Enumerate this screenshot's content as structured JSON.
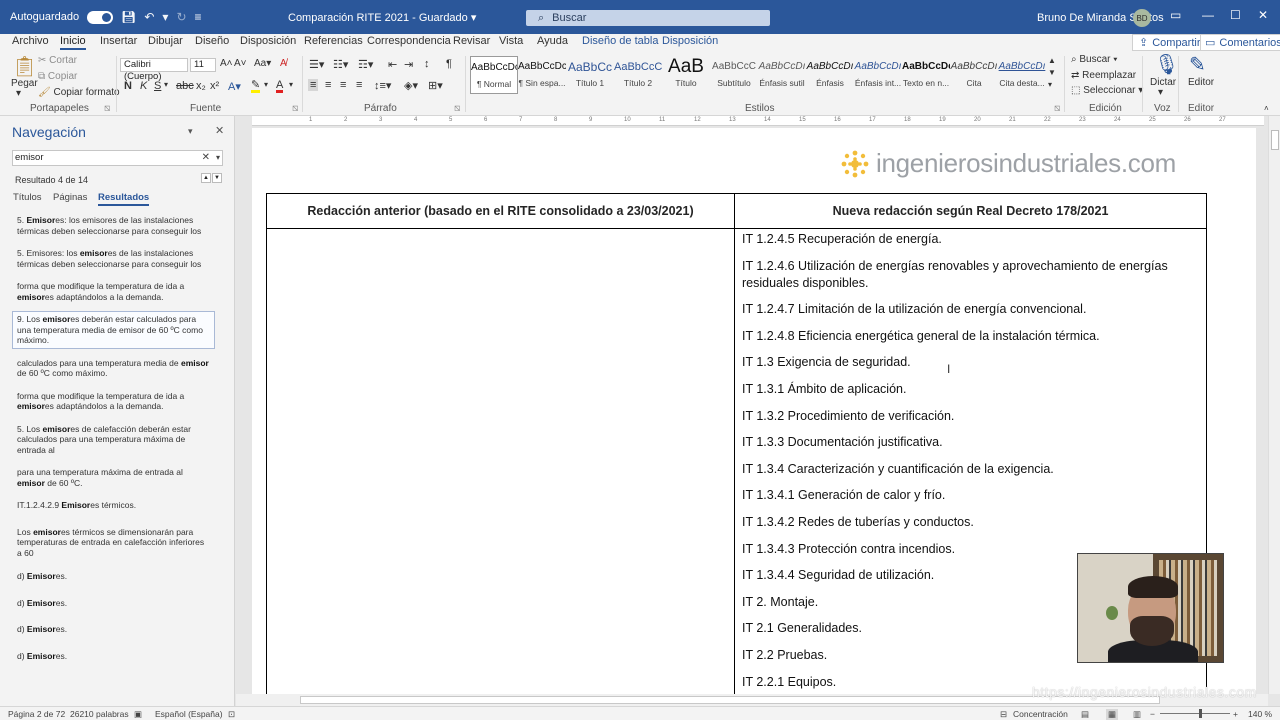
{
  "titlebar": {
    "autosave_label": "Autoguardado",
    "doc_title": "Comparación RITE 2021",
    "save_state": "Guardado",
    "search_placeholder": "Buscar",
    "user_name": "Bruno De Miranda Santos",
    "user_initials": "BD"
  },
  "menu": {
    "tabs": [
      "Archivo",
      "Inicio",
      "Insertar",
      "Dibujar",
      "Diseño",
      "Disposición",
      "Referencias",
      "Correspondencia",
      "Revisar",
      "Vista",
      "Ayuda",
      "Diseño de tabla",
      "Disposición"
    ],
    "active_tab": "Inicio",
    "share": "Compartir",
    "comments": "Comentarios"
  },
  "ribbon": {
    "clipboard": {
      "paste": "Pegar",
      "cut": "Cortar",
      "copy": "Copiar",
      "format_painter": "Copiar formato",
      "label": "Portapapeles"
    },
    "font": {
      "name": "Calibri (Cuerpo)",
      "size": "11",
      "label": "Fuente"
    },
    "paragraph": {
      "label": "Párrafo"
    },
    "styles": {
      "label": "Estilos",
      "items": [
        {
          "sample": "AaBbCcDc",
          "name": "¶ Normal"
        },
        {
          "sample": "AaBbCcDc",
          "name": "¶ Sin espa..."
        },
        {
          "sample": "AaBbCc",
          "name": "Título 1"
        },
        {
          "sample": "AaBbCcC",
          "name": "Título 2"
        },
        {
          "sample": "AaB",
          "name": "Título"
        },
        {
          "sample": "AaBbCcC",
          "name": "Subtítulo"
        },
        {
          "sample": "AaBbCcDı",
          "name": "Énfasis sutil"
        },
        {
          "sample": "AaBbCcDı",
          "name": "Énfasis"
        },
        {
          "sample": "AaBbCcDı",
          "name": "Énfasis int..."
        },
        {
          "sample": "AaBbCcDc",
          "name": "Texto en n..."
        },
        {
          "sample": "AaBbCcDı",
          "name": "Cita"
        },
        {
          "sample": "AaBbCcDı",
          "name": "Cita desta..."
        }
      ]
    },
    "editing": {
      "find": "Buscar",
      "replace": "Reemplazar",
      "select": "Seleccionar",
      "label": "Edición"
    },
    "voice": {
      "dictate": "Dictar",
      "label": "Voz"
    },
    "editor": {
      "button": "Editor",
      "label": "Editor"
    }
  },
  "nav": {
    "title": "Navegación",
    "search_value": "emisor",
    "result_count": "Resultado 4 de 14",
    "tabs": [
      "Títulos",
      "Páginas",
      "Resultados"
    ],
    "active_tab": "Resultados",
    "results": [
      {
        "pre": "5. ",
        "hit": "Emisor",
        "post": "es: los emisores de las instalaciones térmicas deben seleccionarse para conseguir los"
      },
      {
        "pre": "5. Emisores: los ",
        "hit": "emisor",
        "post": "es de las instalaciones térmicas deben seleccionarse para conseguir los"
      },
      {
        "pre": "forma que modifique la temperatura de ida a ",
        "hit": "emisor",
        "post": "es adaptándolos a la demanda."
      },
      {
        "pre": "9. Los ",
        "hit": "emisor",
        "post": "es deberán estar calculados para una temperatura media de emisor de 60 ºC como máximo."
      },
      {
        "pre": "calculados para una temperatura media de ",
        "hit": "emisor",
        "post": " de 60 ºC como máximo."
      },
      {
        "pre": "forma que modifique la temperatura de ida a ",
        "hit": "emisor",
        "post": "es adaptándolos a la demanda."
      },
      {
        "pre": "5. Los ",
        "hit": "emisor",
        "post": "es de calefacción deberán estar calculados para una temperatura máxima de entrada al"
      },
      {
        "pre": "para una temperatura máxima de entrada al ",
        "hit": "emisor",
        "post": " de 60 ºC."
      },
      {
        "pre": "IT.1.2.4.2.9 ",
        "hit": "Emisor",
        "post": "es térmicos."
      },
      {
        "pre": "Los ",
        "hit": "emisor",
        "post": "es térmicos se dimensionarán para temperaturas de entrada en calefacción inferiores a 60"
      },
      {
        "pre": "d) ",
        "hit": "Emisor",
        "post": "es."
      },
      {
        "pre": "d) ",
        "hit": "Emisor",
        "post": "es."
      },
      {
        "pre": "d) ",
        "hit": "Emisor",
        "post": "es."
      },
      {
        "pre": "d) ",
        "hit": "Emisor",
        "post": "es."
      }
    ],
    "selected_index": 3
  },
  "document": {
    "logo_text": "ingenierosindustriales.com",
    "table_headers": [
      "Redacción anterior (basado en el RITE consolidado a 23/03/2021)",
      "Nueva redacción según Real Decreto 178/2021"
    ],
    "right_column": [
      "IT 1.2.4.5 Recuperación de energía.",
      "IT 1.2.4.6 Utilización de energías renovables y aprovechamiento de energías residuales disponibles.",
      "IT 1.2.4.7 Limitación de la utilización de energía convencional.",
      "IT 1.2.4.8 Eficiencia energética general de la instalación térmica.",
      "IT 1.3 Exigencia de seguridad.",
      "IT 1.3.1 Ámbito de aplicación.",
      "IT 1.3.2 Procedimiento de verificación.",
      "IT 1.3.3 Documentación justificativa.",
      "IT 1.3.4 Caracterización y cuantificación de la exigencia.",
      "IT 1.3.4.1 Generación de calor y frío.",
      "IT 1.3.4.2 Redes de tuberías y conductos.",
      "IT 1.3.4.3 Protección contra incendios.",
      "IT 1.3.4.4 Seguridad de utilización.",
      "IT 2. Montaje.",
      "IT 2.1 Generalidades.",
      "IT 2.2 Pruebas.",
      "IT 2.2.1 Equipos."
    ]
  },
  "watermark": "https://ingenierosindustriales.com",
  "status": {
    "page": "Página 2 de 72",
    "words": "26210 palabras",
    "language": "Español (España)",
    "focus": "Concentración",
    "zoom": "140 %"
  }
}
